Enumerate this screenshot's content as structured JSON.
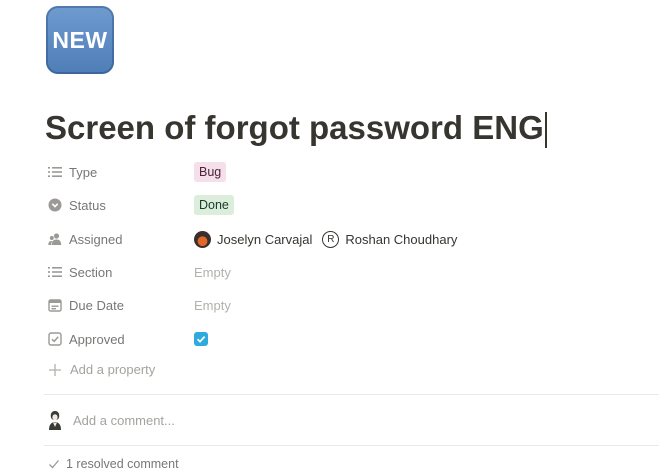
{
  "page": {
    "icon_text": "NEW",
    "title": "Screen of forgot password ENG"
  },
  "properties": {
    "type": {
      "label": "Type",
      "icon": "list-icon",
      "value": "Bug",
      "color": "#f4dfeb"
    },
    "status": {
      "label": "Status",
      "icon": "status-circle-icon",
      "value": "Done",
      "color": "#dbeddb"
    },
    "assigned": {
      "label": "Assigned",
      "icon": "people-icon",
      "people": [
        {
          "name": "Joselyn Carvajal",
          "avatar": "photo-avatar"
        },
        {
          "name": "Roshan Choudhary",
          "initial": "R"
        }
      ]
    },
    "section": {
      "label": "Section",
      "icon": "list-icon",
      "value": "Empty"
    },
    "due_date": {
      "label": "Due Date",
      "icon": "calendar-icon",
      "value": "Empty"
    },
    "approved": {
      "label": "Approved",
      "icon": "checkbox-icon",
      "checked": true,
      "color": "#2eaadc"
    }
  },
  "add_property_label": "Add a property",
  "comments": {
    "placeholder": "Add a comment...",
    "resolved_label": "1 resolved comment"
  }
}
